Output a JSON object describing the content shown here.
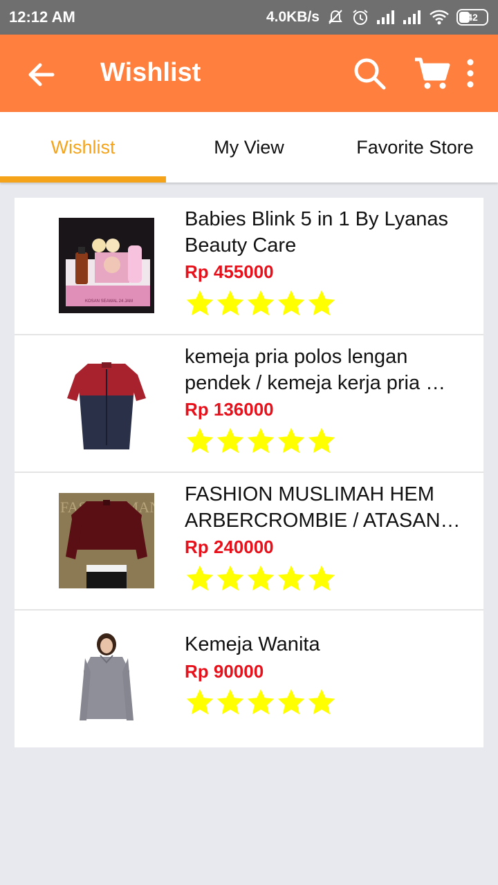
{
  "status": {
    "time": "12:12 AM",
    "speed": "4.0KB/s",
    "battery": "42"
  },
  "appbar": {
    "title": "Wishlist"
  },
  "tabs": [
    {
      "label": "Wishlist",
      "active": true
    },
    {
      "label": "My View",
      "active": false
    },
    {
      "label": "Favorite Store",
      "active": false
    }
  ],
  "items": [
    {
      "name": "Babies Blink 5 in 1 By Lyanas Beauty Care",
      "price": "Rp 455000",
      "rating": 5
    },
    {
      "name": "kemeja pria polos lengan pendek / kemeja kerja pria …",
      "price": "Rp 136000",
      "rating": 5
    },
    {
      "name": "FASHION MUSLIMAH HEM ARBERCROMBIE / ATASAN…",
      "price": "Rp 240000",
      "rating": 5
    },
    {
      "name": "Kemeja Wanita",
      "price": "Rp 90000",
      "rating": 5
    }
  ],
  "thumb_text": {
    "item3_watermark": "FASHIONMAN",
    "item1_box_text": "KOSAN SEAWAL 24 JAM"
  },
  "colors": {
    "accent": "#fe7f3e",
    "tab_active": "#f5a419",
    "price": "#e8101a",
    "star": "#ffff00"
  }
}
